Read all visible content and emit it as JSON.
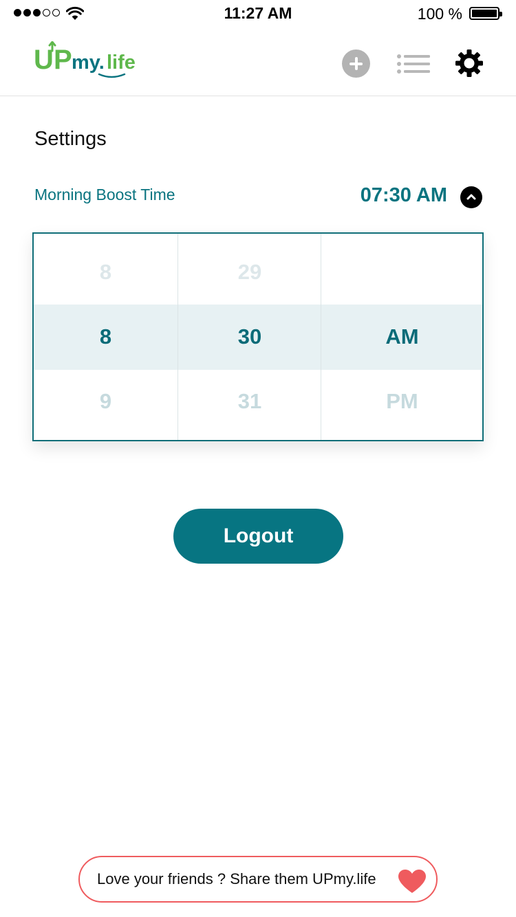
{
  "status_bar": {
    "time": "11:27 AM",
    "battery_percent": "100 %",
    "signal_bars_filled": 3,
    "signal_bars_total": 5
  },
  "header": {
    "logo_text": "UPmy.life",
    "icons": [
      "add-icon",
      "list-icon",
      "gear-icon"
    ]
  },
  "settings": {
    "title": "Settings",
    "boost_label": "Morning Boost Time",
    "boost_value": "07:30 AM"
  },
  "picker": {
    "hours": [
      "8",
      "8",
      "9"
    ],
    "minutes": [
      "29",
      "30",
      "31"
    ],
    "periods": [
      "",
      "AM",
      "PM"
    ]
  },
  "logout_label": "Logout",
  "share_text": "Love your friends ? Share them UPmy.life",
  "colors": {
    "accent": "#077582",
    "logo_green": "#5fb84c",
    "heart": "#ef5b5e"
  }
}
